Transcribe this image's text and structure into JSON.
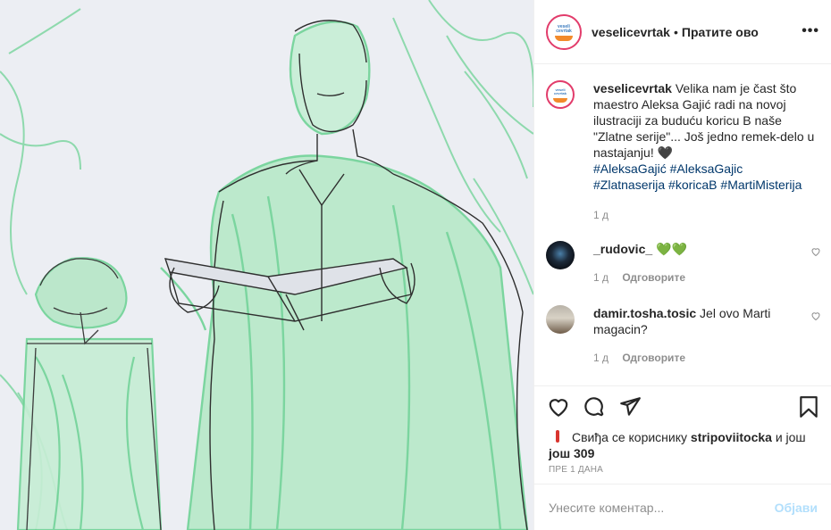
{
  "post": {
    "username": "veselicevrtak",
    "separator": "•",
    "follow_label": "Пратите ово",
    "more_label": "•••",
    "logo_text": "veseli cevrtak"
  },
  "caption": {
    "username": "veselicevrtak",
    "text": "Velika nam je čast što maestro Aleksa Gajić radi na novoj ilustraciji za buduću koricu B naše \"Zlatne serije\"... Još jedno remek-delo u nastajanju! 🖤",
    "hashtags": [
      "#AleksaGajić",
      "#AleksaGajic",
      "#Zlatnaserija",
      "#koricaB",
      "#MartiMisterija"
    ],
    "time": "1 д"
  },
  "comments": [
    {
      "username": "_rudovic_",
      "text": "💚💚",
      "time": "1 д",
      "reply_label": "Одговорите"
    },
    {
      "username": "damir.tosha.tosic",
      "text": "Jel ovo Marti magacin?",
      "time": "1 д",
      "reply_label": "Одговорите"
    }
  ],
  "likes": {
    "prefix": "Свиђа се кориснику",
    "user": "stripoviitocka",
    "middle": "и још",
    "count": "још 309"
  },
  "timestamp": "ПРЕ 1 ДАНА",
  "comment_box": {
    "placeholder": "Унесите коментар...",
    "post_label": "Објави"
  },
  "icons": {
    "like": "heart-icon",
    "comment": "comment-icon",
    "share": "paper-plane-icon",
    "save": "bookmark-icon"
  },
  "colors": {
    "sketch_green": "#5fcf8a",
    "link": "#00376b",
    "muted": "#8e8e8e",
    "post_button_disabled": "#b2dffc",
    "story_ring": "#e23c6b"
  }
}
